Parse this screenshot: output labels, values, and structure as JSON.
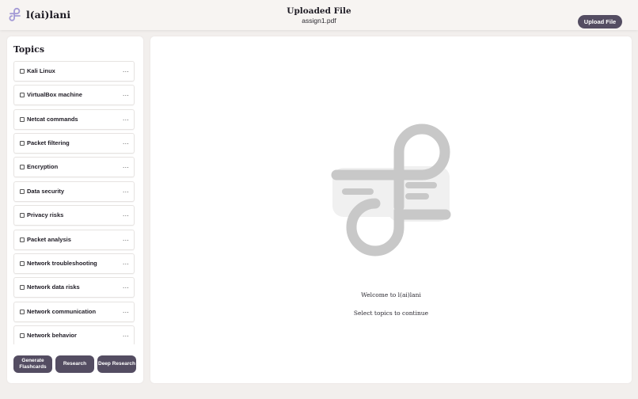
{
  "header": {
    "brand": "l(ai)lani",
    "file_title": "Uploaded File",
    "file_name": "assign1.pdf",
    "upload_label": "Upload File"
  },
  "sidebar": {
    "title": "Topics",
    "more_label": "...",
    "topics": [
      "Kali Linux",
      "VirtualBox machine",
      "Netcat commands",
      "Packet filtering",
      "Encryption",
      "Data security",
      "Privacy risks",
      "Packet analysis",
      "Network troubleshooting",
      "Network data risks",
      "Network communication",
      "Network behavior"
    ],
    "actions": {
      "flashcards": "Generate Flashcards",
      "research": "Research",
      "deep_research": "Deep Research"
    }
  },
  "main": {
    "welcome": "Welcome to l(ai)lani",
    "hint": "Select topics to continue"
  },
  "colors": {
    "accent": "#544d62",
    "logo": "#a49ad6",
    "placeholder_graphic": "#c8c8c8",
    "background": "#f2efed"
  },
  "icons": {
    "logo": "lailani-logo-icon",
    "hero": "lailani-logo-placeholder-icon"
  }
}
